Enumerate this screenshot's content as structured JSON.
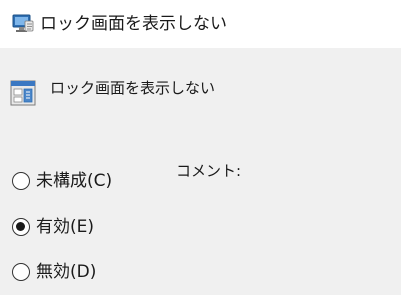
{
  "window": {
    "title": "ロック画面を表示しない",
    "icon": "group-policy-setting-icon"
  },
  "header": {
    "title": "ロック画面を表示しない",
    "icon": "policy-setting-icon"
  },
  "options": [
    {
      "label": "未構成(C)",
      "checked": false
    },
    {
      "label": "有効(E)",
      "checked": true
    },
    {
      "label": "無効(D)",
      "checked": false
    }
  ],
  "comment": {
    "label": "コメント:"
  },
  "colors": {
    "titlebar_bg": "#ffffff",
    "dialog_bg": "#f0f0f0",
    "text": "#1a1a1a"
  }
}
